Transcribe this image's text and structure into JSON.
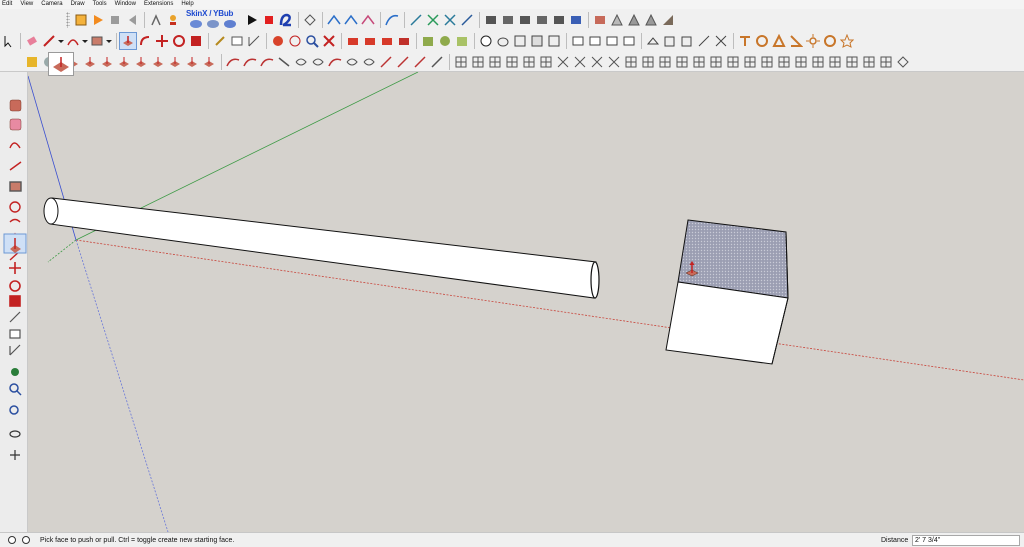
{
  "menu": [
    "Edit",
    "View",
    "Camera",
    "Draw",
    "Tools",
    "Window",
    "Extensions",
    "Help"
  ],
  "toolbar": {
    "plugin_label": "SkinX / YBub"
  },
  "colors": {
    "viewport_bg": "#d5d2cd",
    "axis_red": "#c8443a",
    "axis_green": "#3d9a45",
    "axis_blue": "#3a4fd0",
    "selected_face": "#8f94a8"
  },
  "icons": {
    "row1": [
      "orbit-icon",
      "play-icon",
      "stop-icon",
      "prev-icon",
      "walk-icon",
      "position-camera-icon",
      "record-icon",
      "stop-record-icon",
      "spiral-icon",
      "rotate-icon",
      "curve-icon",
      "arc-icon",
      "bezier-icon",
      "edit-curve-icon",
      "sections-icon"
    ],
    "row2": [
      "select-icon",
      "eraser-icon",
      "pencil-icon",
      "arc-tool-icon",
      "rectangle-icon",
      "push-pull-icon",
      "follow-me-icon",
      "move-icon",
      "rotate-tool-icon",
      "scale-icon",
      "tape-measure-icon",
      "text-icon",
      "paint-bucket-icon",
      "orbit-tool-icon",
      "pan-icon",
      "zoom-icon"
    ],
    "row3": [
      "gear-icon",
      "push-pull-small-icon"
    ]
  },
  "status": {
    "hint": "Pick face to push or pull.  Ctrl = toggle create new starting face.",
    "measure_label": "Distance",
    "measure_value": "2' 7 3/4\""
  }
}
